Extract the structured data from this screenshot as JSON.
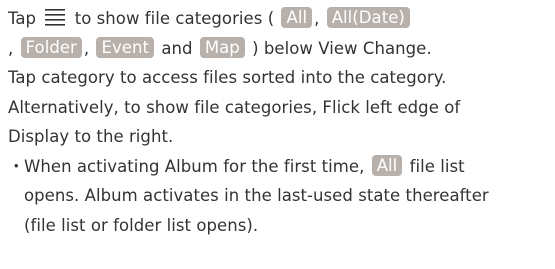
{
  "paragraph1": {
    "line1": {
      "tap": "Tap",
      "to_show": "to show file categories (",
      "all": "All",
      "comma1": ",",
      "all_date": "All(Date)"
    },
    "line2": {
      "comma_lead": ",",
      "folder": "Folder",
      "comma2": ",",
      "event": "Event",
      "and": "and",
      "map": "Map",
      "tail": ") below View Change."
    }
  },
  "paragraph2": {
    "line1": "Tap category to access files sorted into the category.",
    "line2": "Alternatively, to show file categories, Flick left edge of",
    "line3": "Display to the right."
  },
  "note": {
    "bullet": "・",
    "line1_pre": "When activating Album for the first time,",
    "all": "All",
    "line1_post": "file list",
    "line2": "opens. Album activates in the last-used state thereafter",
    "line3": "(file list or folder list opens)."
  },
  "icons": {
    "menu": "menu-icon"
  },
  "colors": {
    "text": "#333333",
    "chip_bg": "#b7b0ab",
    "chip_text": "#ffffff"
  }
}
